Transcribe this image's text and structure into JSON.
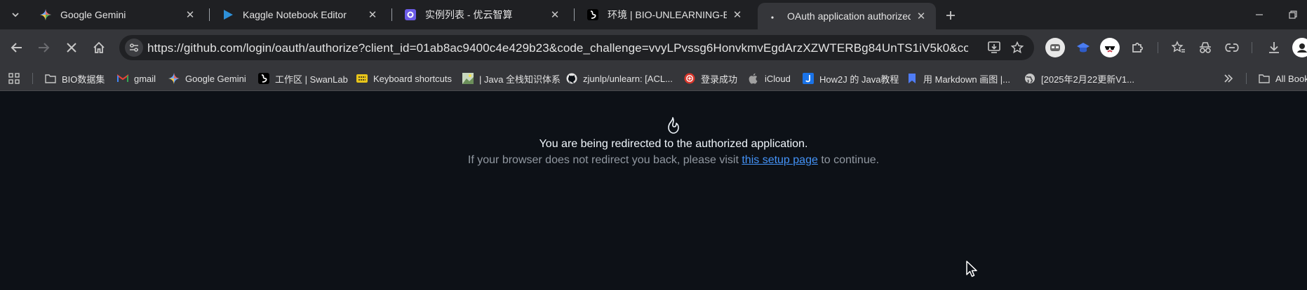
{
  "tabs": [
    {
      "title": "Google Gemini",
      "icon": "gemini-icon",
      "active": false
    },
    {
      "title": "Kaggle Notebook Editor",
      "icon": "kaggle-play-icon",
      "active": false
    },
    {
      "title": "实例列表 - 优云智算",
      "icon": "ucloud-icon",
      "active": false
    },
    {
      "title": "环境 | BIO-UNLEARNING-BASE",
      "icon": "swanlab-icon",
      "active": false
    },
    {
      "title": "OAuth application authorized",
      "icon": "loading-dot-icon",
      "active": true
    }
  ],
  "toolbar": {
    "url": "https://github.com/login/oauth/authorize?client_id=01ab8ac9400c4e429b23&code_challenge=vvyLPvssg6HonvkmvEgdArzXZWTERBg84UnTS1iV5k0&code_ch..."
  },
  "bookmarks": [
    {
      "label": "BIO数据集",
      "icon": "folder-icon"
    },
    {
      "label": "gmail",
      "icon": "gmail-icon"
    },
    {
      "label": "Google Gemini",
      "icon": "gemini-icon"
    },
    {
      "label": "工作区 | SwanLab",
      "icon": "swanlab-icon"
    },
    {
      "label": "Keyboard shortcuts",
      "icon": "keyboard-icon"
    },
    {
      "label": "| Java 全栈知识体系",
      "icon": "image-icon"
    },
    {
      "label": "zjunlp/unlearn: [ACL...",
      "icon": "github-icon"
    },
    {
      "label": "登录成功",
      "icon": "login-icon"
    },
    {
      "label": "iCloud",
      "icon": "apple-icon"
    },
    {
      "label": "How2J 的 Java教程",
      "icon": "how2j-icon"
    },
    {
      "label": "用 Markdown 画图 |...",
      "icon": "bookmark-blue-icon"
    },
    {
      "label": "[2025年2月22更新V1...",
      "icon": "globe-icon"
    }
  ],
  "all_bookmarks_label": "All Bookmarks",
  "page": {
    "message": "You are being redirected to the authorized application.",
    "sub_prefix": "If your browser does not redirect you back, please visit",
    "sub_link": "this setup page",
    "sub_suffix": "to continue."
  },
  "colors": {
    "page_bg": "#0d1117",
    "link": "#4493f8",
    "chrome_toolbar": "#35363a",
    "tabstrip": "#1f2023"
  }
}
